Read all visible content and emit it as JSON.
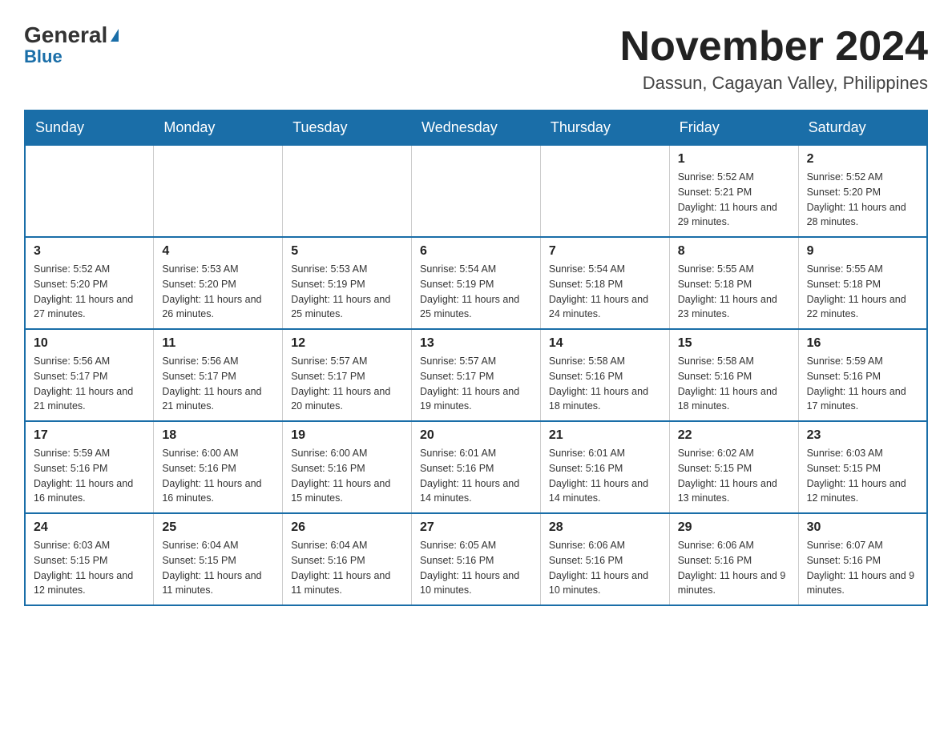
{
  "logo": {
    "general": "General",
    "blue": "Blue",
    "arrow": "▶"
  },
  "title": "November 2024",
  "subtitle": "Dassun, Cagayan Valley, Philippines",
  "weekdays": [
    "Sunday",
    "Monday",
    "Tuesday",
    "Wednesday",
    "Thursday",
    "Friday",
    "Saturday"
  ],
  "weeks": [
    [
      {
        "day": "",
        "info": ""
      },
      {
        "day": "",
        "info": ""
      },
      {
        "day": "",
        "info": ""
      },
      {
        "day": "",
        "info": ""
      },
      {
        "day": "",
        "info": ""
      },
      {
        "day": "1",
        "info": "Sunrise: 5:52 AM\nSunset: 5:21 PM\nDaylight: 11 hours and 29 minutes."
      },
      {
        "day": "2",
        "info": "Sunrise: 5:52 AM\nSunset: 5:20 PM\nDaylight: 11 hours and 28 minutes."
      }
    ],
    [
      {
        "day": "3",
        "info": "Sunrise: 5:52 AM\nSunset: 5:20 PM\nDaylight: 11 hours and 27 minutes."
      },
      {
        "day": "4",
        "info": "Sunrise: 5:53 AM\nSunset: 5:20 PM\nDaylight: 11 hours and 26 minutes."
      },
      {
        "day": "5",
        "info": "Sunrise: 5:53 AM\nSunset: 5:19 PM\nDaylight: 11 hours and 25 minutes."
      },
      {
        "day": "6",
        "info": "Sunrise: 5:54 AM\nSunset: 5:19 PM\nDaylight: 11 hours and 25 minutes."
      },
      {
        "day": "7",
        "info": "Sunrise: 5:54 AM\nSunset: 5:18 PM\nDaylight: 11 hours and 24 minutes."
      },
      {
        "day": "8",
        "info": "Sunrise: 5:55 AM\nSunset: 5:18 PM\nDaylight: 11 hours and 23 minutes."
      },
      {
        "day": "9",
        "info": "Sunrise: 5:55 AM\nSunset: 5:18 PM\nDaylight: 11 hours and 22 minutes."
      }
    ],
    [
      {
        "day": "10",
        "info": "Sunrise: 5:56 AM\nSunset: 5:17 PM\nDaylight: 11 hours and 21 minutes."
      },
      {
        "day": "11",
        "info": "Sunrise: 5:56 AM\nSunset: 5:17 PM\nDaylight: 11 hours and 21 minutes."
      },
      {
        "day": "12",
        "info": "Sunrise: 5:57 AM\nSunset: 5:17 PM\nDaylight: 11 hours and 20 minutes."
      },
      {
        "day": "13",
        "info": "Sunrise: 5:57 AM\nSunset: 5:17 PM\nDaylight: 11 hours and 19 minutes."
      },
      {
        "day": "14",
        "info": "Sunrise: 5:58 AM\nSunset: 5:16 PM\nDaylight: 11 hours and 18 minutes."
      },
      {
        "day": "15",
        "info": "Sunrise: 5:58 AM\nSunset: 5:16 PM\nDaylight: 11 hours and 18 minutes."
      },
      {
        "day": "16",
        "info": "Sunrise: 5:59 AM\nSunset: 5:16 PM\nDaylight: 11 hours and 17 minutes."
      }
    ],
    [
      {
        "day": "17",
        "info": "Sunrise: 5:59 AM\nSunset: 5:16 PM\nDaylight: 11 hours and 16 minutes."
      },
      {
        "day": "18",
        "info": "Sunrise: 6:00 AM\nSunset: 5:16 PM\nDaylight: 11 hours and 16 minutes."
      },
      {
        "day": "19",
        "info": "Sunrise: 6:00 AM\nSunset: 5:16 PM\nDaylight: 11 hours and 15 minutes."
      },
      {
        "day": "20",
        "info": "Sunrise: 6:01 AM\nSunset: 5:16 PM\nDaylight: 11 hours and 14 minutes."
      },
      {
        "day": "21",
        "info": "Sunrise: 6:01 AM\nSunset: 5:16 PM\nDaylight: 11 hours and 14 minutes."
      },
      {
        "day": "22",
        "info": "Sunrise: 6:02 AM\nSunset: 5:15 PM\nDaylight: 11 hours and 13 minutes."
      },
      {
        "day": "23",
        "info": "Sunrise: 6:03 AM\nSunset: 5:15 PM\nDaylight: 11 hours and 12 minutes."
      }
    ],
    [
      {
        "day": "24",
        "info": "Sunrise: 6:03 AM\nSunset: 5:15 PM\nDaylight: 11 hours and 12 minutes."
      },
      {
        "day": "25",
        "info": "Sunrise: 6:04 AM\nSunset: 5:15 PM\nDaylight: 11 hours and 11 minutes."
      },
      {
        "day": "26",
        "info": "Sunrise: 6:04 AM\nSunset: 5:16 PM\nDaylight: 11 hours and 11 minutes."
      },
      {
        "day": "27",
        "info": "Sunrise: 6:05 AM\nSunset: 5:16 PM\nDaylight: 11 hours and 10 minutes."
      },
      {
        "day": "28",
        "info": "Sunrise: 6:06 AM\nSunset: 5:16 PM\nDaylight: 11 hours and 10 minutes."
      },
      {
        "day": "29",
        "info": "Sunrise: 6:06 AM\nSunset: 5:16 PM\nDaylight: 11 hours and 9 minutes."
      },
      {
        "day": "30",
        "info": "Sunrise: 6:07 AM\nSunset: 5:16 PM\nDaylight: 11 hours and 9 minutes."
      }
    ]
  ]
}
